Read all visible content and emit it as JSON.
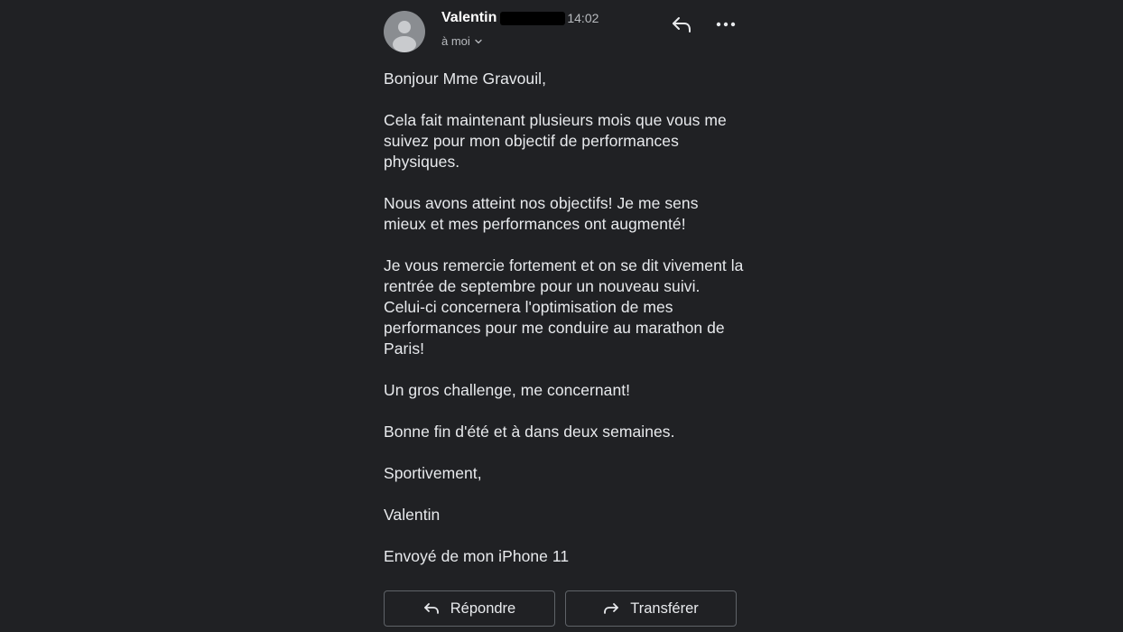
{
  "sender": {
    "name": "Valentin",
    "time": "14:02",
    "recipient": "à moi"
  },
  "body": {
    "paragraphs": [
      "Bonjour Mme Gravouil,",
      "Cela fait maintenant plusieurs mois que vous me suivez pour mon objectif de performances physiques.",
      "Nous avons atteint nos objectifs! Je me sens mieux et mes performances ont augmenté!",
      "Je vous remercie fortement et on se dit vivement la rentrée de septembre pour un nouveau suivi. Celui-ci concernera l'optimisation de mes performances pour me conduire au marathon de Paris!",
      "Un gros challenge, me concernant!",
      "Bonne fin d'été et à dans deux semaines.",
      "Sportivement,",
      "Valentin",
      "Envoyé de mon iPhone 11"
    ]
  },
  "actions": {
    "reply_label": "Répondre",
    "forward_label": "Transférer"
  },
  "icons": {
    "avatar": "person-avatar-icon",
    "reply": "reply-arrow-icon",
    "more": "more-horizontal-icon",
    "recipient_expand": "chevron-down-icon",
    "forward": "forward-arrow-icon"
  },
  "colors": {
    "background": "#202124",
    "text": "#e8eaed",
    "muted": "#b8bbbf",
    "border": "#5f6368",
    "avatar": "#8a8d91"
  }
}
